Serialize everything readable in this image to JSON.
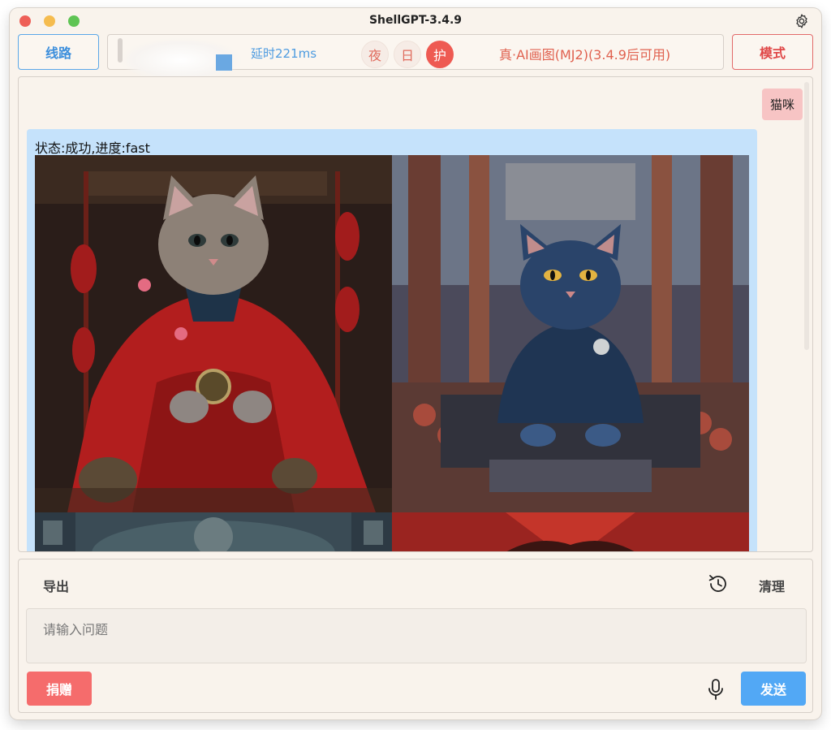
{
  "window": {
    "title": "ShellGPT-3.4.9"
  },
  "toolbar": {
    "route_label": "线路",
    "latency": "延时221ms",
    "night_label": "夜",
    "day_label": "日",
    "guard_label": "护",
    "model_label": "真·AI画图(MJ2)(3.4.9后可用)",
    "mode_label": "模式"
  },
  "chat": {
    "user_message": "猫咪",
    "bot_status": "状态:成功,进度:fast",
    "images": [
      {
        "icon": "cat-red-robe-image"
      },
      {
        "icon": "cat-blue-throne-image"
      },
      {
        "icon": "ornate-temple-image"
      },
      {
        "icon": "red-geometric-image"
      }
    ]
  },
  "bottom": {
    "export_label": "导出",
    "clear_label": "清理",
    "input_placeholder": "请输入问题",
    "donate_label": "捐赠",
    "send_label": "发送"
  },
  "colors": {
    "accent_blue": "#52a8f5",
    "accent_red": "#f56c6c",
    "background": "#f9f3ec",
    "bot_bubble": "#c5e2fb",
    "user_bubble": "#f7c4c4"
  }
}
